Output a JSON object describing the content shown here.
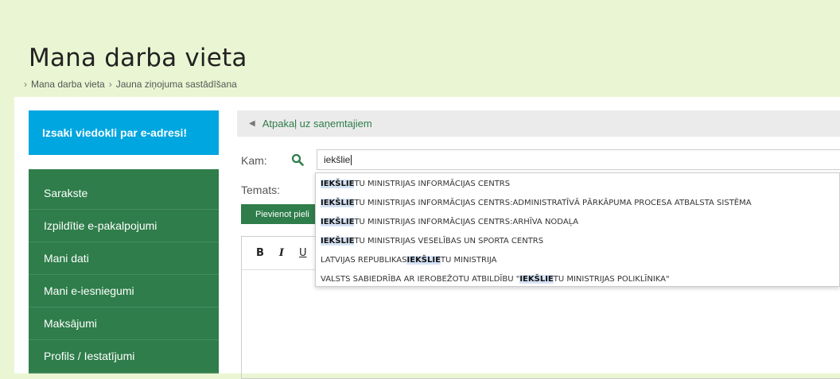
{
  "page": {
    "title": "Mana darba vieta"
  },
  "breadcrumb": {
    "items": [
      "Mana darba vieta",
      "Jauna ziņojuma sastādīšana"
    ],
    "separator": "›"
  },
  "sidebar": {
    "feedback_label": "Izsaki viedokli par e-adresi!",
    "items": [
      {
        "label": "Sarakste"
      },
      {
        "label": "Izpildītie e-pakalpojumi"
      },
      {
        "label": "Mani dati"
      },
      {
        "label": "Mani e-iesniegumi"
      },
      {
        "label": "Maksājumi"
      },
      {
        "label": "Profils / Iestatījumi"
      }
    ]
  },
  "main": {
    "back_label": "Atpakaļ uz saņemtajiem",
    "to_label": "Kam:",
    "recipient_value": "iekšlie",
    "subject_label": "Temats:",
    "attach_label": "Pievienot pieli",
    "toolbar": {
      "bold": "B",
      "italic": "I",
      "underline": "U"
    }
  },
  "autocomplete": {
    "items": [
      {
        "prefix": "",
        "match": "IEKŠLIE",
        "suffix": "TU MINISTRIJAS INFORMĀCIJAS CENTRS"
      },
      {
        "prefix": "",
        "match": "IEKŠLIE",
        "suffix": "TU MINISTRIJAS INFORMĀCIJAS CENTRS:ADMINISTRATĪVĀ PĀRKĀPUMA PROCESA ATBALSTA SISTĒMA"
      },
      {
        "prefix": "",
        "match": "IEKŠLIE",
        "suffix": "TU MINISTRIJAS INFORMĀCIJAS CENTRS:ARHĪVA NODAĻA"
      },
      {
        "prefix": "",
        "match": "IEKŠLIE",
        "suffix": "TU MINISTRIJAS VESELĪBAS UN SPORTA CENTRS"
      },
      {
        "prefix": "LATVIJAS REPUBLIKAS ",
        "match": "IEKŠLIE",
        "suffix": "TU MINISTRIJA"
      },
      {
        "prefix": "VALSTS SABIEDRĪBA AR IEROBEŽOTU ATBILDĪBU \"",
        "match": "IEKŠLIE",
        "suffix": "TU MINISTRIJAS POLIKLĪNIKA\""
      }
    ]
  },
  "colors": {
    "page_bg": "#eaf6d3",
    "accent_green": "#2e7d4a",
    "accent_blue": "#00a6e0",
    "highlight": "#d6e3f5"
  },
  "icons": {
    "search": "search-icon",
    "back": "arrow-left-icon"
  }
}
